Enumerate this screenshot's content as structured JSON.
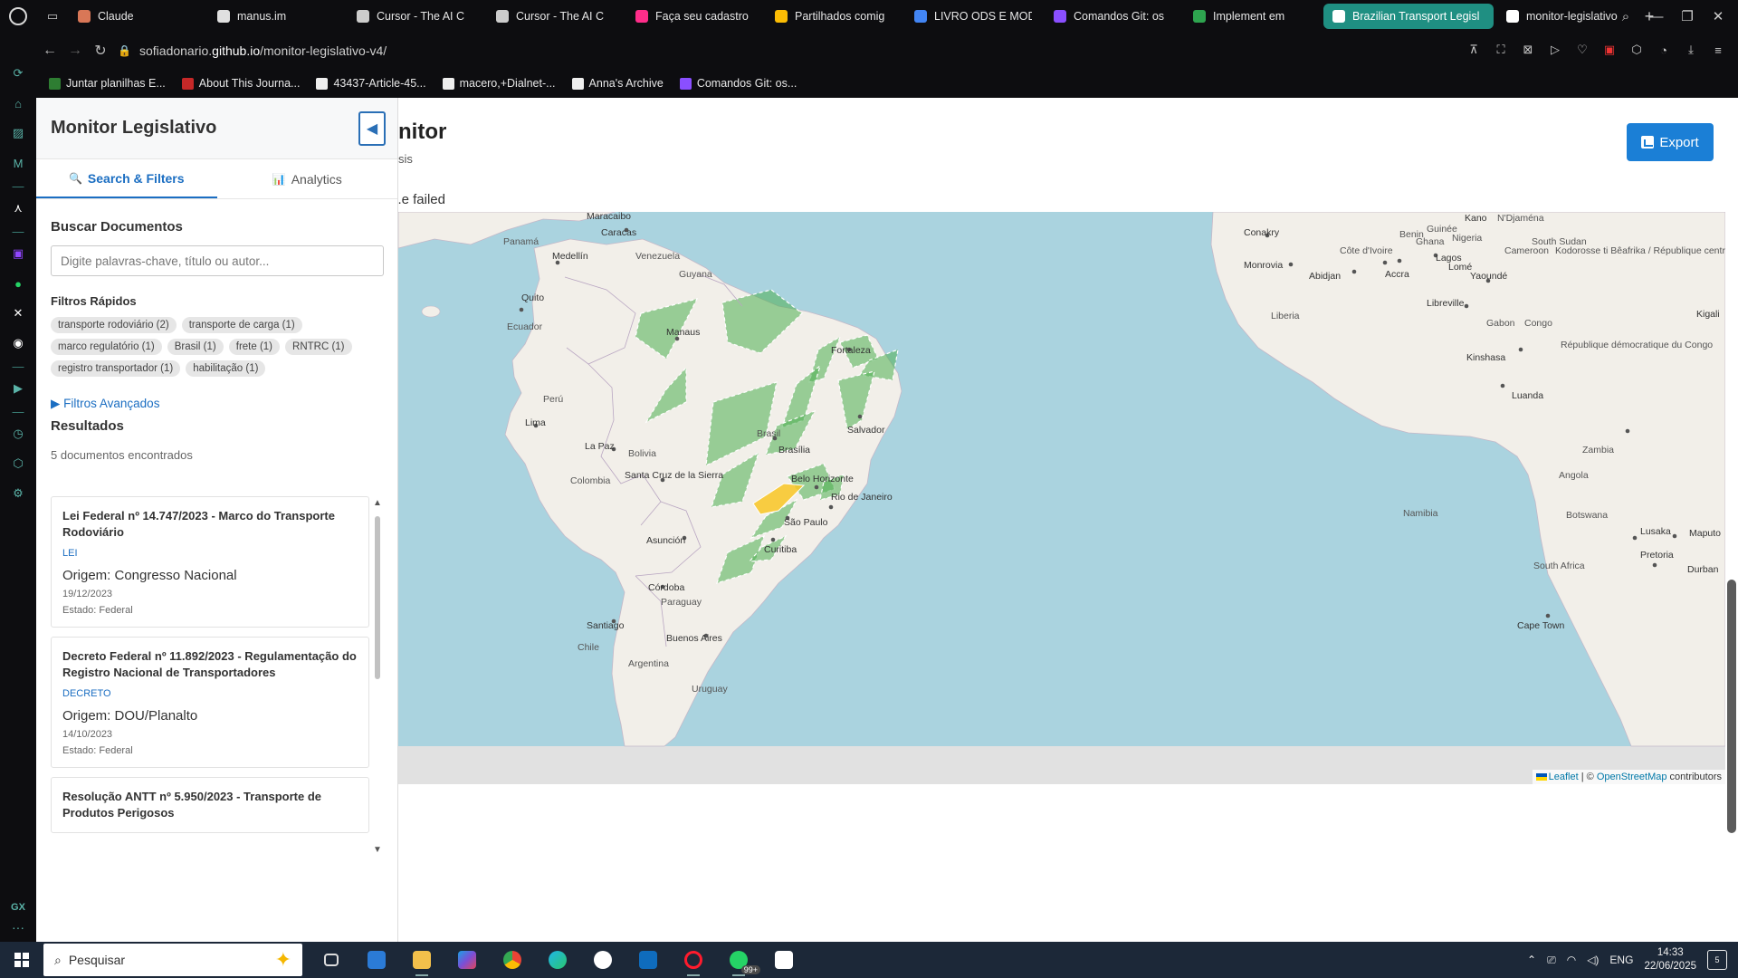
{
  "browser": {
    "tabs": [
      {
        "title": "Claude",
        "color": "#d97757"
      },
      {
        "title": "manus.im",
        "color": "#e0e0e0"
      },
      {
        "title": "Cursor - The AI C",
        "color": "#cccccc"
      },
      {
        "title": "Cursor - The AI C",
        "color": "#cccccc"
      },
      {
        "title": "Faça seu cadastro",
        "color": "#ff2d8a"
      },
      {
        "title": "Partilhados comig",
        "color": "#fbbc04"
      },
      {
        "title": "LIVRO ODS E MOD",
        "color": "#4285f4"
      },
      {
        "title": "Comandos Git: os",
        "color": "#8a4fff"
      },
      {
        "title": "Implement em",
        "color": "#2ea44f"
      },
      {
        "title": "Brazilian Transport Legisl",
        "color": "#ffffff"
      },
      {
        "title": "monitor-legislativo",
        "color": "#ffffff"
      }
    ],
    "active_tab_index": 9,
    "url_prefix": "sofiadonario.",
    "url_host": "github.io",
    "url_path": "/monitor-legislativo-v4/",
    "bookmarks": [
      {
        "label": "Juntar planilhas E...",
        "color": "#2e7d32"
      },
      {
        "label": "About This Journa...",
        "color": "#c62828"
      },
      {
        "label": "43437-Article-45...",
        "color": "#eeeeee"
      },
      {
        "label": "macero,+Dialnet-...",
        "color": "#eeeeee"
      },
      {
        "label": "Anna's Archive",
        "color": "#eeeeee"
      },
      {
        "label": "Comandos Git: os...",
        "color": "#8a4fff"
      }
    ]
  },
  "panel": {
    "title": "Monitor Legislativo",
    "collapse_icon": "◀",
    "tabs": [
      {
        "icon": "🔍",
        "label": "Search & Filters"
      },
      {
        "icon": "📊",
        "label": "Analytics"
      }
    ],
    "search_heading": "Buscar Documentos",
    "search_placeholder": "Digite palavras-chave, título ou autor...",
    "quick_filters_heading": "Filtros Rápidos",
    "quick_filters": [
      "transporte rodoviário (2)",
      "transporte de carga (1)",
      "marco regulatório (1)",
      "Brasil (1)",
      "frete (1)",
      "RNTRC (1)",
      "registro transportador (1)",
      "habilitação (1)"
    ],
    "advanced_filters": "▶ Filtros Avançados",
    "results_heading": "Resultados",
    "results_count": "5 documentos encontrados",
    "results": [
      {
        "title": "Lei Federal nº 14.747/2023 - Marco do Transporte Rodoviário",
        "type": "LEI",
        "origin": "Origem: Congresso Nacional",
        "date": "19/12/2023",
        "state": "Estado: Federal"
      },
      {
        "title": "Decreto Federal nº 11.892/2023 - Regulamentação do Registro Nacional de Transportadores",
        "type": "DECRETO",
        "origin": "Origem: DOU/Planalto",
        "date": "14/10/2023",
        "state": "Estado: Federal"
      },
      {
        "title": "Resolução ANTT nº 5.950/2023 - Transporte de Produtos Perigosos",
        "type": "",
        "origin": "",
        "date": "",
        "state": ""
      }
    ]
  },
  "main": {
    "title_visible": "nitor",
    "subtitle_visible": "sis",
    "status_visible": "e failed.",
    "export_label": "Export"
  },
  "map": {
    "ocean_color": "#aad3df",
    "land_color": "#f2efe9",
    "highlight_color": "#4caf50",
    "selected_color": "#f9c623",
    "labels": {
      "countries": [
        "Venezuela",
        "Colombia",
        "Ecuador",
        "Perú",
        "Bolivia",
        "Paraguay",
        "Chile",
        "Argentina",
        "Uruguay",
        "Guyana",
        "Panamá",
        "Brasil",
        "Liberia",
        "Ghana",
        "Benin",
        "Nigeria",
        "Cameroon",
        "Gabon",
        "Congo",
        "Angola",
        "Namibia",
        "Botswana",
        "Zambia",
        "South Africa",
        "Guinée",
        "Côte d'Ivoire",
        "South Sudan",
        "Kodorosse ti Bêafrika / République centrafricaine",
        "République démocratique du Congo",
        "N'Djaména"
      ],
      "cities": [
        "Maracaibo",
        "Caracas",
        "Medellín",
        "Quito",
        "Manaus",
        "Fortaleza",
        "Lima",
        "La Paz",
        "Santa Cruz de la Sierra",
        "Brasília",
        "Salvador",
        "Belo Horizonte",
        "Rio de Janeiro",
        "São Paulo",
        "Asunción",
        "Curitiba",
        "Córdoba",
        "Santiago",
        "Buenos Aires",
        "Conakry",
        "Monrovia",
        "Abidjan",
        "Accra",
        "Lomé",
        "Lagos",
        "Yaoundé",
        "Libreville",
        "Kinshasa",
        "Luanda",
        "Lusaka",
        "Pretoria",
        "Maputo",
        "Durban",
        "Cape Town",
        "Kano",
        "Kigali"
      ]
    },
    "attribution_leaflet": "Leaflet",
    "attribution_sep": " | © ",
    "attribution_osm": "OpenStreetMap",
    "attribution_tail": " contributors"
  },
  "taskbar": {
    "search_placeholder": "Pesquisar",
    "lang": "ENG",
    "time": "14:33",
    "date": "22/06/2025",
    "whatsapp_badge": "99+",
    "notif_count": "5"
  }
}
